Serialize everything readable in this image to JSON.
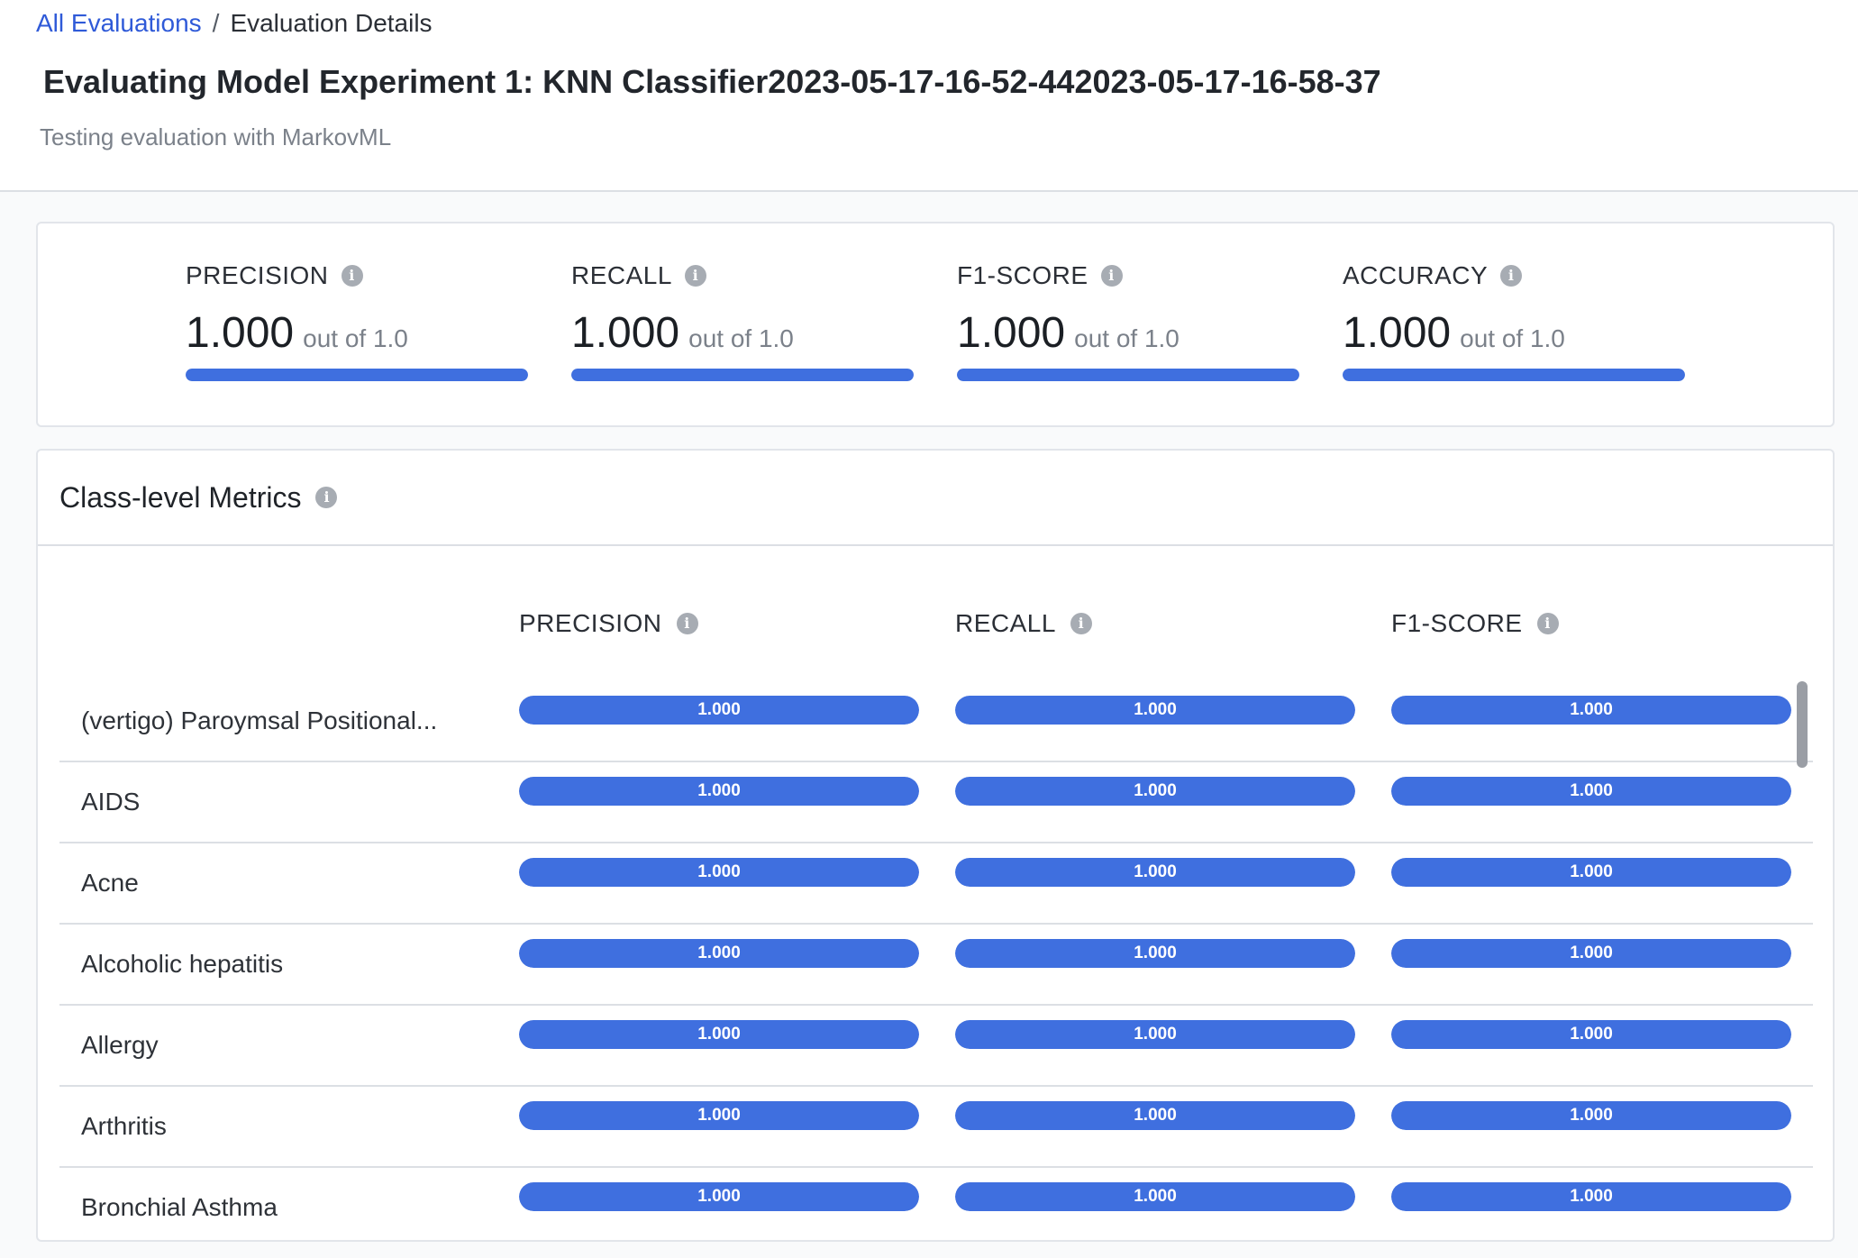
{
  "breadcrumb": {
    "parent": "All Evaluations",
    "separator": "/",
    "current": "Evaluation Details"
  },
  "page": {
    "title": "Evaluating Model Experiment 1: KNN Classifier2023-05-17-16-52-442023-05-17-16-58-37",
    "subtitle": "Testing evaluation with MarkovML"
  },
  "summary": {
    "out_of_label": "out of 1.0",
    "metrics": [
      {
        "label": "PRECISION",
        "value": "1.000",
        "fraction": 1.0
      },
      {
        "label": "RECALL",
        "value": "1.000",
        "fraction": 1.0
      },
      {
        "label": "F1-SCORE",
        "value": "1.000",
        "fraction": 1.0
      },
      {
        "label": "ACCURACY",
        "value": "1.000",
        "fraction": 1.0
      }
    ]
  },
  "class_metrics": {
    "title": "Class-level Metrics",
    "columns": [
      "PRECISION",
      "RECALL",
      "F1-SCORE"
    ],
    "rows": [
      {
        "name": "(vertigo) Paroymsal Positional...",
        "values": [
          "1.000",
          "1.000",
          "1.000"
        ],
        "fractions": [
          1.0,
          1.0,
          1.0
        ]
      },
      {
        "name": "AIDS",
        "values": [
          "1.000",
          "1.000",
          "1.000"
        ],
        "fractions": [
          1.0,
          1.0,
          1.0
        ]
      },
      {
        "name": "Acne",
        "values": [
          "1.000",
          "1.000",
          "1.000"
        ],
        "fractions": [
          1.0,
          1.0,
          1.0
        ]
      },
      {
        "name": "Alcoholic hepatitis",
        "values": [
          "1.000",
          "1.000",
          "1.000"
        ],
        "fractions": [
          1.0,
          1.0,
          1.0
        ]
      },
      {
        "name": "Allergy",
        "values": [
          "1.000",
          "1.000",
          "1.000"
        ],
        "fractions": [
          1.0,
          1.0,
          1.0
        ]
      },
      {
        "name": "Arthritis",
        "values": [
          "1.000",
          "1.000",
          "1.000"
        ],
        "fractions": [
          1.0,
          1.0,
          1.0
        ]
      },
      {
        "name": "Bronchial Asthma",
        "values": [
          "1.000",
          "1.000",
          "1.000"
        ],
        "fractions": [
          1.0,
          1.0,
          1.0
        ]
      }
    ]
  },
  "icons": {
    "info": "info-icon",
    "info_glyph": "i"
  },
  "colors": {
    "accent": "#3f6fdf",
    "link": "#2f5ad8"
  }
}
